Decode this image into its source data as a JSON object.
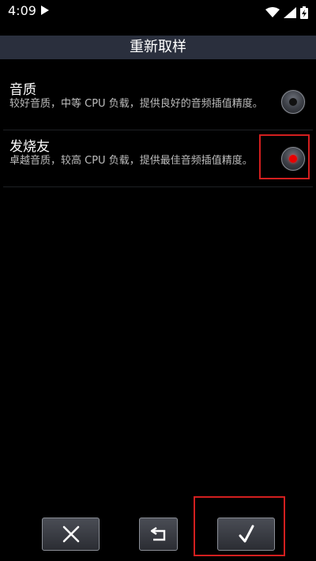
{
  "status_bar": {
    "time": "4:09"
  },
  "dialog": {
    "title": "重新取样",
    "options": [
      {
        "title": "音质",
        "description": "较好音质，中等 CPU 负载，提供良好的音频插值精度。",
        "selected": false
      },
      {
        "title": "发烧友",
        "description": "卓越音质，较高 CPU 负载，提供最佳音频插值精度。",
        "selected": true
      }
    ]
  },
  "buttons": {
    "cancel_icon": "close-icon",
    "revert_icon": "undo-icon",
    "confirm_icon": "check-icon"
  },
  "colors": {
    "selected_dot": "#e80000",
    "highlight": "#d31f1f",
    "titlebar": "#2a2f3d"
  }
}
